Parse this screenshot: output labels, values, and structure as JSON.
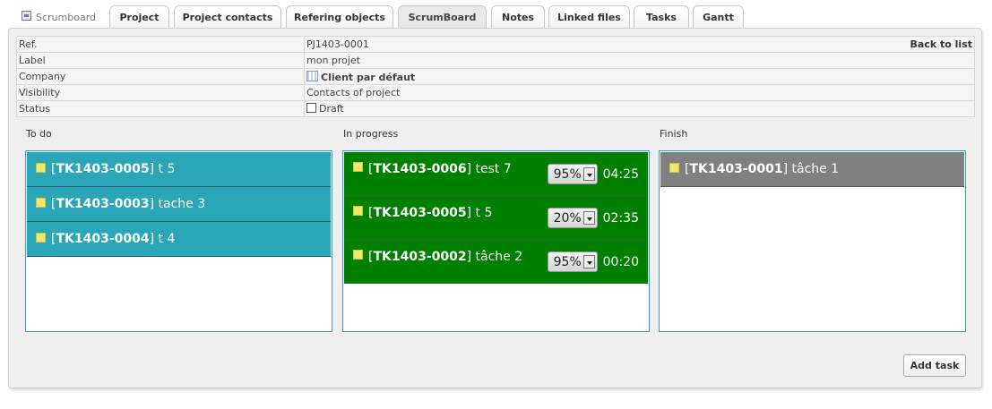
{
  "brand": {
    "label": "Scrumboard",
    "icon": "scrumboard-icon"
  },
  "tabs": [
    {
      "label": "Project"
    },
    {
      "label": "Project contacts"
    },
    {
      "label": "Refering objects"
    },
    {
      "label": "ScrumBoard",
      "active": true
    },
    {
      "label": "Notes"
    },
    {
      "label": "Linked files"
    },
    {
      "label": "Tasks"
    },
    {
      "label": "Gantt"
    }
  ],
  "info": {
    "ref_label": "Ref.",
    "ref_value": "PJ1403-0001",
    "back_label": "Back to list",
    "label_label": "Label",
    "label_value": "mon projet",
    "company_label": "Company",
    "company_value": "Client par défaut",
    "company_icon": "company-icon",
    "visibility_label": "Visibility",
    "visibility_value": "Contacts of project",
    "status_label": "Status",
    "status_value": "Draft"
  },
  "columns": {
    "todo": {
      "title": "To do",
      "color": "#2aa6b8",
      "tasks": [
        {
          "ref": "TK1403-0005",
          "name": "t 5"
        },
        {
          "ref": "TK1403-0003",
          "name": "tache 3"
        },
        {
          "ref": "TK1403-0004",
          "name": "t 4"
        }
      ]
    },
    "progress": {
      "title": "In progress",
      "color": "#008000",
      "tasks": [
        {
          "ref": "TK1403-0006",
          "name": "test 7",
          "percent": "95%",
          "time": "04:25"
        },
        {
          "ref": "TK1403-0005",
          "name": "t 5",
          "percent": "20%",
          "time": "02:35"
        },
        {
          "ref": "TK1403-0002",
          "name": "tâche 2",
          "percent": "95%",
          "time": "00:20"
        }
      ]
    },
    "finish": {
      "title": "Finish",
      "color": "#808080",
      "tasks": [
        {
          "ref": "TK1403-0001",
          "name": "tâche 1"
        }
      ]
    }
  },
  "actions": {
    "add_task": "Add task"
  }
}
